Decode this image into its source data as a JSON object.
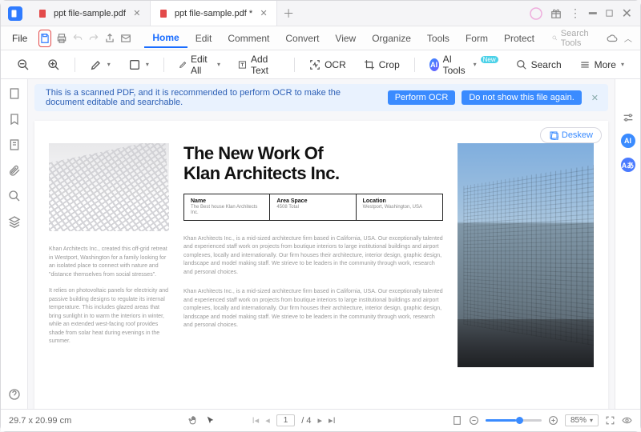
{
  "tabs": [
    {
      "label": "ppt file-sample.pdf"
    },
    {
      "label": "ppt file-sample.pdf *"
    }
  ],
  "file_label": "File",
  "menu": [
    "Home",
    "Edit",
    "Comment",
    "Convert",
    "View",
    "Organize",
    "Tools",
    "Form",
    "Protect"
  ],
  "search_tools_placeholder": "Search Tools",
  "toolbar": {
    "edit_all": "Edit All",
    "add_text": "Add Text",
    "ocr": "OCR",
    "crop": "Crop",
    "ai_tools": "AI Tools",
    "ai_badge": "New",
    "search": "Search",
    "more": "More"
  },
  "banner": {
    "msg": "This is a scanned PDF, and it is recommended to perform OCR to make the document editable and searchable.",
    "perform": "Perform OCR",
    "dont_show": "Do not show this file again."
  },
  "deskew_label": "Deskew",
  "doc": {
    "title_l1": "The New Work Of",
    "title_l2": "Klan Architects Inc.",
    "meta": {
      "name_lbl": "Name",
      "name_val": "The Best house Klan Architects Inc.",
      "area_lbl": "Area Space",
      "area_val": "4508 Total",
      "loc_lbl": "Location",
      "loc_val": "Westport, Washington, USA"
    },
    "left_p1": "Khan Architects Inc., created this off-grid retreat in Westport, Washington for a family looking for an isolated place to connect with nature and \"distance themselves from social stresses\".",
    "left_p2": "It relies on photovoltaic panels for electricity and passive building designs to regulate its internal temperature. This includes glazed areas that bring sunlight in to warm the interiors in winter, while an extended west-facing roof provides shade from solar heat during evenings in the summer.",
    "center_p1": "Khan Architects Inc., is a mid-sized architecture firm based in California, USA. Our exceptionally talented and experienced staff work on projects from boutique interiors to large institutional buildings and airport complexes, locally and internationally. Our firm houses their architecture, interior design, graphic design, landscape and model making staff. We strieve to be leaders in the community through work, research and personal choices.",
    "center_p2": "Khan Architects Inc., is a mid-sized architecture firm based in California, USA. Our exceptionally talented and experienced staff work on projects from boutique interiors to large institutional buildings and airport complexes, locally and internationally. Our firm houses their architecture, interior design, graphic design, landscape and model making staff. We strieve to be leaders in the community through work, research and personal choices."
  },
  "status": {
    "dims": "29.7 x 20.99 cm",
    "page_current": "1",
    "page_total": "/ 4",
    "zoom": "85%"
  }
}
